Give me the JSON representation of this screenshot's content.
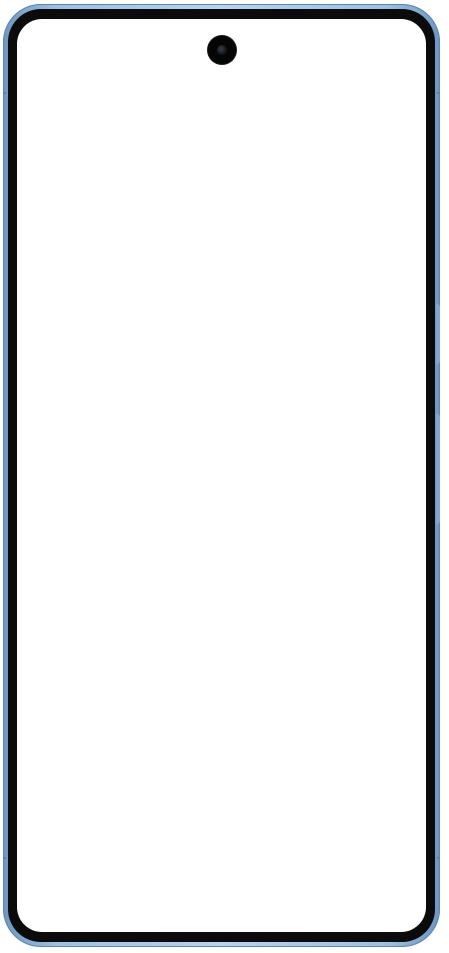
{
  "device": {
    "type": "smartphone",
    "frame_color": "#a9c7e6",
    "bezel_color": "#0b0b0c",
    "screen_color": "#ffffff",
    "screen_state": "blank"
  }
}
